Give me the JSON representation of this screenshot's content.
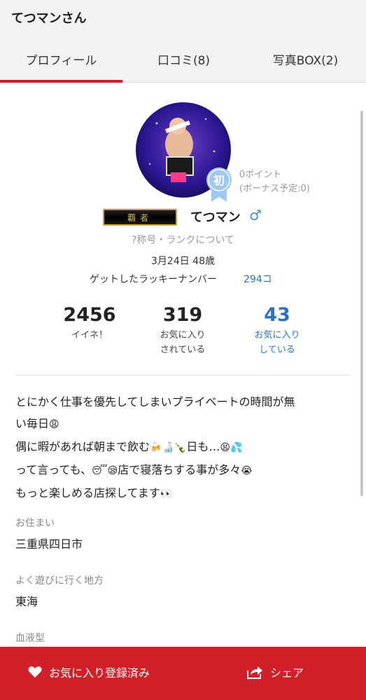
{
  "header": {
    "title": "てつマンさん"
  },
  "tabs": [
    {
      "label": "プロフィール"
    },
    {
      "label": "口コミ(8)"
    },
    {
      "label": "写真BOX(2)"
    }
  ],
  "profile": {
    "badge_char": "初",
    "points": "0ポイント",
    "bonus": "(ボーナス予定:0)",
    "rank_title": "覇者",
    "username": "てつマン",
    "gender": "♂",
    "rank_link": "?称号・ランクについて",
    "birth_age": "3月24日 48歳",
    "lucky_label": "ゲットしたラッキーナンバー",
    "lucky_value": "294コ"
  },
  "stats": [
    {
      "number": "2456",
      "label1": "イイネ！",
      "label2": ""
    },
    {
      "number": "319",
      "label1": "お気に入り",
      "label2": "されている"
    },
    {
      "number": "43",
      "label1": "お気に入り",
      "label2": "している"
    }
  ],
  "bio": {
    "line1": "とにかく仕事を優先してしまいプライベートの時間が無",
    "line2": "い毎日",
    "line3": "偶に暇があれば朝まで飲む",
    "line3b": "日も…",
    "line4a": "って言っても、",
    "line4b": "店で寝落ちする事が多々",
    "line5": "もっと楽しめる店探してます"
  },
  "fields": [
    {
      "label": "お住まい",
      "value": "三重県四日市"
    },
    {
      "label": "よく遊びに行く地方",
      "value": "東海"
    },
    {
      "label": "血液型",
      "value": ""
    }
  ],
  "bottom": {
    "favorite_label": "お気に入り登録済み",
    "share_label": "シェア"
  },
  "colors": {
    "accent": "#d0202a",
    "link": "#2a72c8",
    "gender": "#3b8ed8",
    "badge": "#9ec8ef"
  }
}
